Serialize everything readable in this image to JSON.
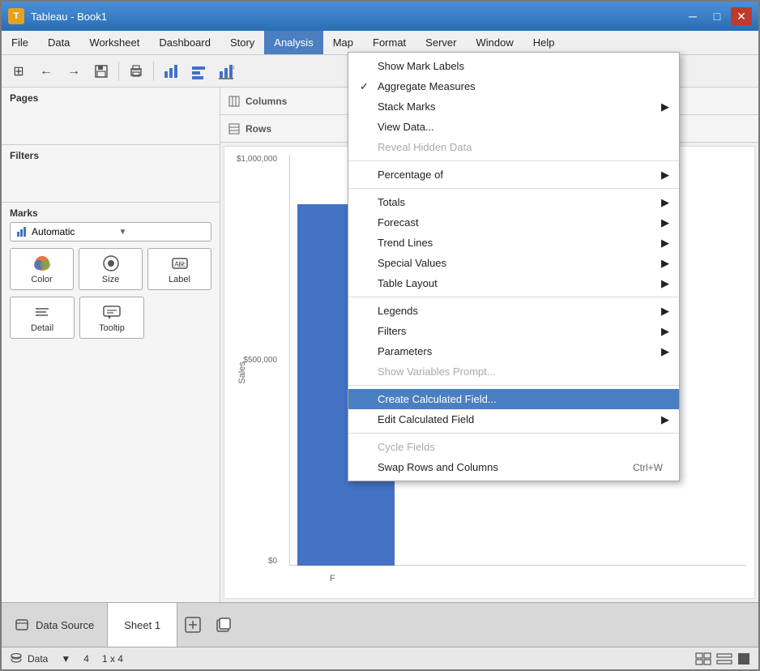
{
  "window": {
    "title": "Tableau - Book1",
    "icon": "T"
  },
  "titlebar": {
    "minimize": "─",
    "maximize": "□",
    "close": "✕"
  },
  "menubar": {
    "items": [
      {
        "label": "File",
        "active": false
      },
      {
        "label": "Data",
        "active": false
      },
      {
        "label": "Worksheet",
        "active": false
      },
      {
        "label": "Dashboard",
        "active": false
      },
      {
        "label": "Story",
        "active": false
      },
      {
        "label": "Analysis",
        "active": true
      },
      {
        "label": "Map",
        "active": false
      },
      {
        "label": "Format",
        "active": false
      },
      {
        "label": "Server",
        "active": false
      },
      {
        "label": "Window",
        "active": false
      },
      {
        "label": "Help",
        "active": false
      }
    ]
  },
  "toolbar": {
    "buttons": [
      "⊞",
      "←",
      "→",
      "💾",
      "📋",
      "📊",
      "📈",
      "📉",
      "✕"
    ]
  },
  "panels": {
    "pages_title": "Pages",
    "filters_title": "Filters",
    "marks_title": "Marks",
    "marks_type": "Automatic",
    "marks_buttons": [
      {
        "label": "Color",
        "icon": "color"
      },
      {
        "label": "Size",
        "icon": "size"
      },
      {
        "label": "Label",
        "icon": "label"
      },
      {
        "label": "Detail",
        "icon": "detail"
      },
      {
        "label": "Tooltip",
        "icon": "tooltip"
      }
    ]
  },
  "shelves": {
    "columns_icon": "⊞",
    "columns_label": "Columns",
    "rows_icon": "☰",
    "rows_label": "Rows"
  },
  "chart": {
    "y_axis_labels": [
      "$1,000,000",
      "$500,000",
      "$0"
    ],
    "x_axis_label": "F",
    "y_axis_title": "Sales",
    "bar_height_pct": 85
  },
  "analysis_menu": {
    "items": [
      {
        "label": "Show Mark Labels",
        "shortcut": "",
        "has_submenu": false,
        "disabled": false,
        "checked": false,
        "highlighted": false,
        "separator_after": false
      },
      {
        "label": "Aggregate Measures",
        "shortcut": "",
        "has_submenu": false,
        "disabled": false,
        "checked": true,
        "highlighted": false,
        "separator_after": false
      },
      {
        "label": "Stack Marks",
        "shortcut": "",
        "has_submenu": true,
        "disabled": false,
        "checked": false,
        "highlighted": false,
        "separator_after": false
      },
      {
        "label": "View Data...",
        "shortcut": "",
        "has_submenu": false,
        "disabled": false,
        "checked": false,
        "highlighted": false,
        "separator_after": false
      },
      {
        "label": "Reveal Hidden Data",
        "shortcut": "",
        "has_submenu": false,
        "disabled": true,
        "checked": false,
        "highlighted": false,
        "separator_after": true
      },
      {
        "label": "Percentage of",
        "shortcut": "",
        "has_submenu": true,
        "disabled": false,
        "checked": false,
        "highlighted": false,
        "separator_after": true
      },
      {
        "label": "Totals",
        "shortcut": "",
        "has_submenu": true,
        "disabled": false,
        "checked": false,
        "highlighted": false,
        "separator_after": false
      },
      {
        "label": "Forecast",
        "shortcut": "",
        "has_submenu": true,
        "disabled": false,
        "checked": false,
        "highlighted": false,
        "separator_after": false
      },
      {
        "label": "Trend Lines",
        "shortcut": "",
        "has_submenu": true,
        "disabled": false,
        "checked": false,
        "highlighted": false,
        "separator_after": false
      },
      {
        "label": "Special Values",
        "shortcut": "",
        "has_submenu": true,
        "disabled": false,
        "checked": false,
        "highlighted": false,
        "separator_after": false
      },
      {
        "label": "Table Layout",
        "shortcut": "",
        "has_submenu": true,
        "disabled": false,
        "checked": false,
        "highlighted": false,
        "separator_after": true
      },
      {
        "label": "Legends",
        "shortcut": "",
        "has_submenu": true,
        "disabled": false,
        "checked": false,
        "highlighted": false,
        "separator_after": false
      },
      {
        "label": "Filters",
        "shortcut": "",
        "has_submenu": true,
        "disabled": false,
        "checked": false,
        "highlighted": false,
        "separator_after": false
      },
      {
        "label": "Parameters",
        "shortcut": "",
        "has_submenu": true,
        "disabled": false,
        "checked": false,
        "highlighted": false,
        "separator_after": false
      },
      {
        "label": "Show Variables Prompt...",
        "shortcut": "",
        "has_submenu": false,
        "disabled": true,
        "checked": false,
        "highlighted": false,
        "separator_after": true
      },
      {
        "label": "Create Calculated Field...",
        "shortcut": "",
        "has_submenu": false,
        "disabled": false,
        "checked": false,
        "highlighted": true,
        "separator_after": false
      },
      {
        "label": "Edit Calculated Field",
        "shortcut": "",
        "has_submenu": true,
        "disabled": false,
        "checked": false,
        "highlighted": false,
        "separator_after": true
      },
      {
        "label": "Cycle Fields",
        "shortcut": "",
        "has_submenu": false,
        "disabled": true,
        "checked": false,
        "highlighted": false,
        "separator_after": false
      },
      {
        "label": "Swap Rows and Columns",
        "shortcut": "Ctrl+W",
        "has_submenu": false,
        "disabled": false,
        "checked": false,
        "highlighted": false,
        "separator_after": false
      }
    ]
  },
  "bottom_tabs": {
    "datasource_label": "Data Source",
    "sheet_label": "Sheet 1",
    "datasource_icon": "☰"
  },
  "status_bar": {
    "db_label": "Data",
    "rows_label": "4",
    "size_label": "1 x 4"
  }
}
